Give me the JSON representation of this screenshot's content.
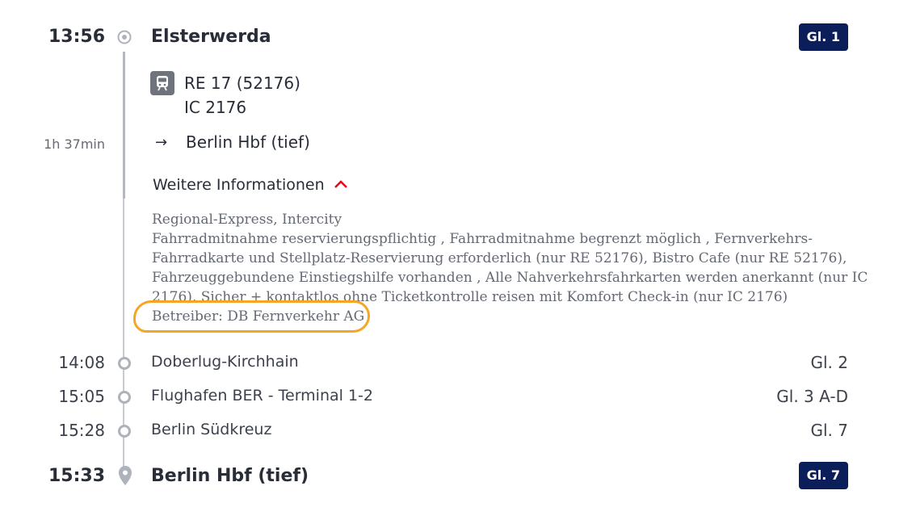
{
  "departure": {
    "time": "13:56",
    "station": "Elsterwerda",
    "platform": "Gl. 1"
  },
  "train": {
    "line1": "RE 17 (52176)",
    "line2": "IC 2176",
    "icon": "train-icon",
    "duration": "1h 37min",
    "direction": "Berlin Hbf (tief)"
  },
  "more_info": {
    "toggle_label": "Weitere Informationen",
    "category": "Regional-Express, Intercity",
    "line1": "Fahrradmitnahme reservierungspflichtig , Fahrradmitnahme begrenzt möglich , Fernverkehrs-",
    "line2": "Fahrradkarte und Stellplatz-Reservierung erforderlich  (nur RE 52176), Bistro Cafe  (nur RE 52176),",
    "line3": "Fahrzeuggebundene Einstiegshilfe vorhanden , Alle Nahverkehrsfahrkarten werden anerkannt (nur IC",
    "line4": "2176), Sicher + kontaktlos ohne Ticketkontrolle reisen mit Komfort Check-in (nur IC 2176)",
    "operator": "Betreiber: DB Fernverkehr AG"
  },
  "stops": [
    {
      "time": "14:08",
      "station": "Doberlug-Kirchhain",
      "platform": "Gl. 2"
    },
    {
      "time": "15:05",
      "station": "Flughafen BER - Terminal 1-2",
      "platform": "Gl. 3 A-D"
    },
    {
      "time": "15:28",
      "station": "Berlin Südkreuz",
      "platform": "Gl. 7"
    }
  ],
  "arrival": {
    "time": "15:33",
    "station": "Berlin Hbf (tief)",
    "platform": "Gl. 7"
  },
  "colors": {
    "badge": "#0c1e5a",
    "accent_red": "#ec0016",
    "annotation": "#f5a623"
  }
}
